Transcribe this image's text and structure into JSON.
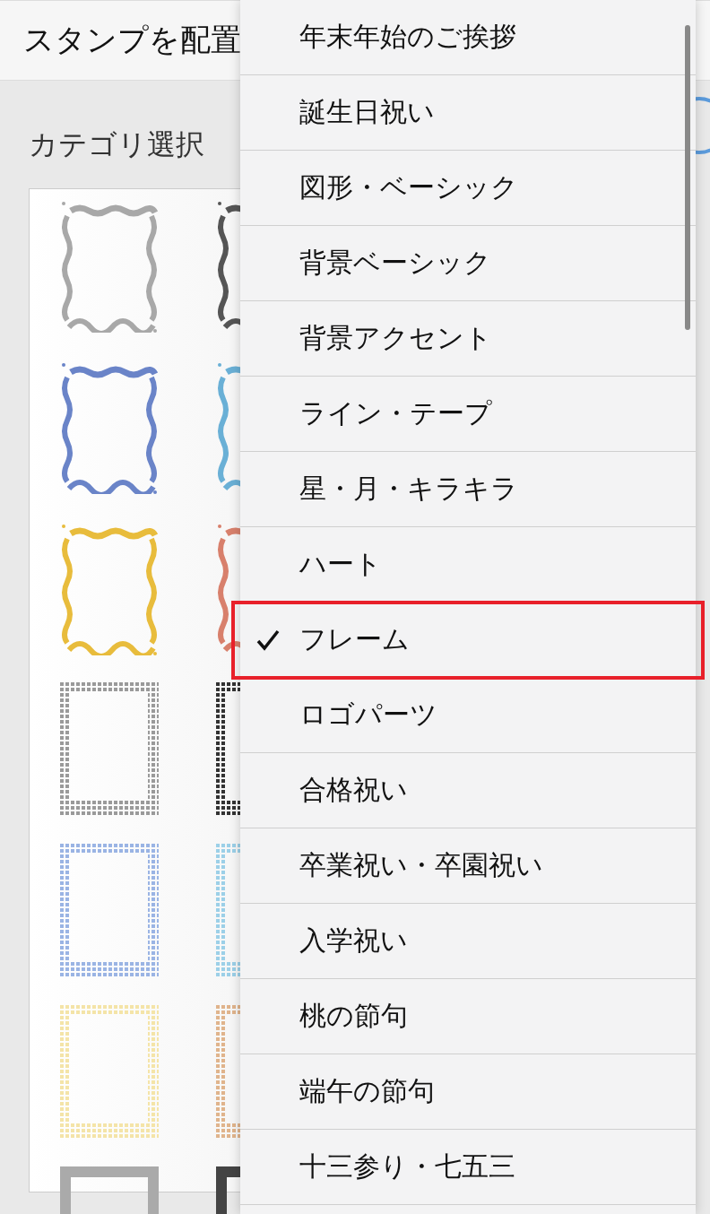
{
  "header": {
    "title": "スタンプを配置"
  },
  "category_label": "カテゴリ選択",
  "stamps": [
    {
      "kind": "ribbon",
      "color": "#a8a8a8"
    },
    {
      "kind": "ribbon",
      "color": "#555555"
    },
    {
      "kind": "ribbon",
      "color": "#6a84c8"
    },
    {
      "kind": "ribbon",
      "color": "#6ab0d6"
    },
    {
      "kind": "ribbon",
      "color": "#e8bc3c"
    },
    {
      "kind": "ribbon",
      "color": "#d8806c"
    },
    {
      "kind": "check",
      "color": "#9a9a9a"
    },
    {
      "kind": "check",
      "color": "#333333"
    },
    {
      "kind": "check",
      "color": "#9ab4e4"
    },
    {
      "kind": "check",
      "color": "#9cd0e8"
    },
    {
      "kind": "check",
      "color": "#f4e4a8"
    },
    {
      "kind": "check",
      "color": "#e0b48c"
    },
    {
      "kind": "solid",
      "color": "#aaaaaa"
    },
    {
      "kind": "solid",
      "color": "#444444"
    }
  ],
  "menu": {
    "items": [
      {
        "label": "年末年始のご挨拶",
        "selected": false
      },
      {
        "label": "誕生日祝い",
        "selected": false
      },
      {
        "label": "図形・ベーシック",
        "selected": false
      },
      {
        "label": "背景ベーシック",
        "selected": false
      },
      {
        "label": "背景アクセント",
        "selected": false
      },
      {
        "label": "ライン・テープ",
        "selected": false
      },
      {
        "label": "星・月・キラキラ",
        "selected": false
      },
      {
        "label": "ハート",
        "selected": false
      },
      {
        "label": "フレーム",
        "selected": true
      },
      {
        "label": "ロゴパーツ",
        "selected": false
      },
      {
        "label": "合格祝い",
        "selected": false
      },
      {
        "label": "卒業祝い・卒園祝い",
        "selected": false
      },
      {
        "label": "入学祝い",
        "selected": false
      },
      {
        "label": "桃の節句",
        "selected": false
      },
      {
        "label": "端午の節句",
        "selected": false
      },
      {
        "label": "十三参り・七五三",
        "selected": false
      }
    ]
  }
}
